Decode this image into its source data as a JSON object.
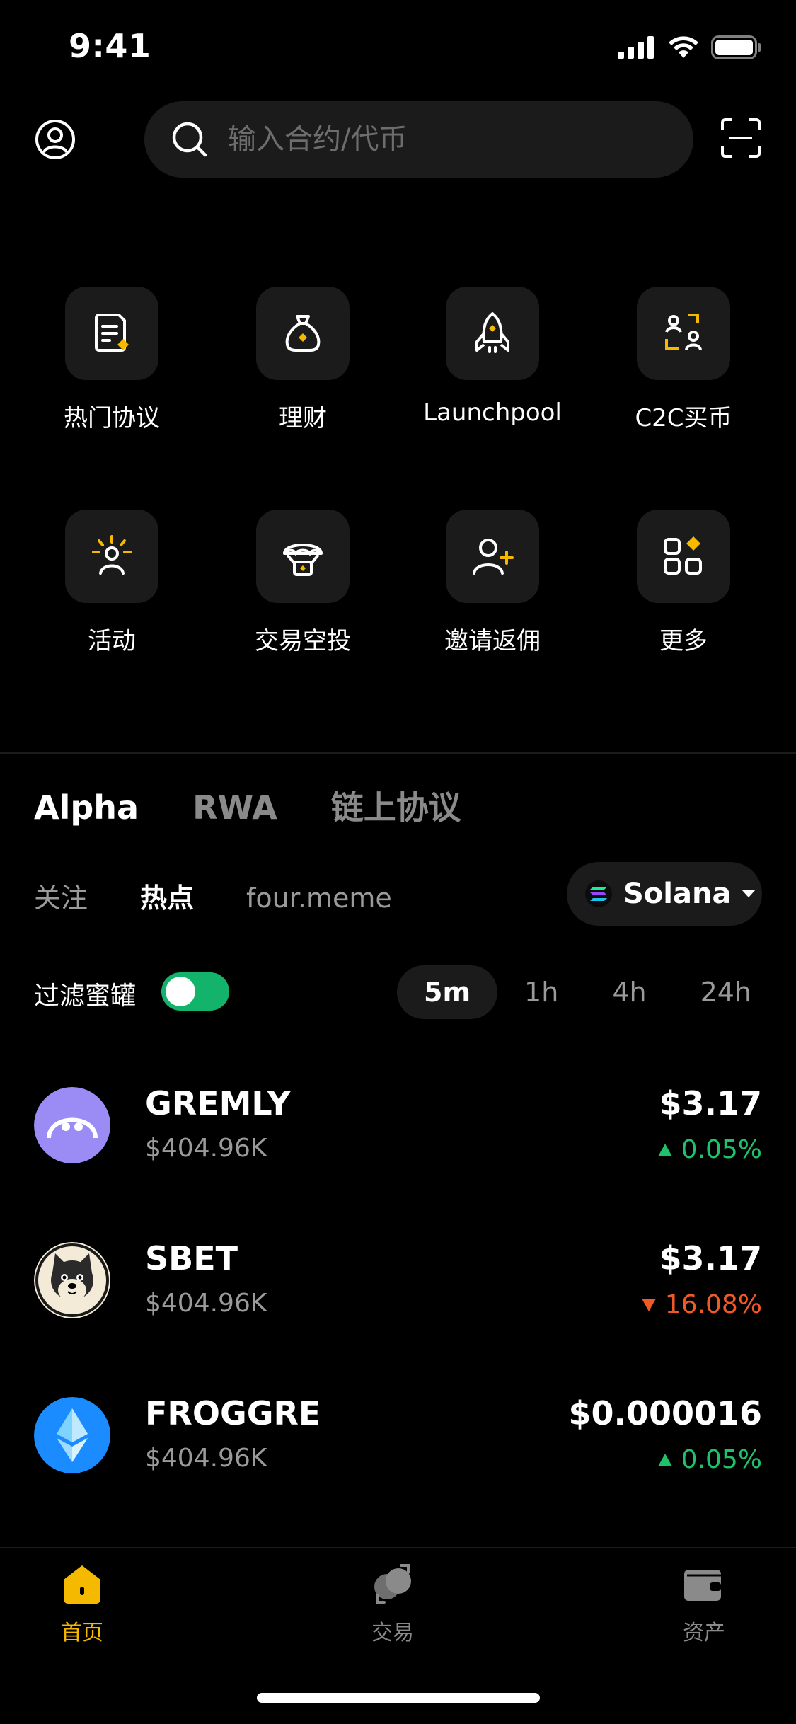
{
  "status": {
    "time": "9:41"
  },
  "search": {
    "placeholder": "输入合约/代币"
  },
  "quick_actions": [
    {
      "label": "热门协议",
      "icon": "document-icon"
    },
    {
      "label": "理财",
      "icon": "money-bag-icon"
    },
    {
      "label": "Launchpool",
      "icon": "rocket-icon"
    },
    {
      "label": "C2C买币",
      "icon": "users-exchange-icon"
    },
    {
      "label": "活动",
      "icon": "sun-person-icon"
    },
    {
      "label": "交易空投",
      "icon": "airdrop-icon"
    },
    {
      "label": "邀请返佣",
      "icon": "add-user-icon"
    },
    {
      "label": "更多",
      "icon": "apps-icon"
    }
  ],
  "main_tabs": [
    {
      "label": "Alpha",
      "active": true
    },
    {
      "label": "RWA",
      "active": false
    },
    {
      "label": "链上协议",
      "active": false
    }
  ],
  "sub_tabs": [
    {
      "label": "关注",
      "active": false
    },
    {
      "label": "热点",
      "active": true
    },
    {
      "label": "four.meme",
      "active": false
    }
  ],
  "chain": {
    "label": "Solana"
  },
  "filter": {
    "label": "过滤蜜罐",
    "enabled": true
  },
  "periods": [
    {
      "label": "5m",
      "active": true
    },
    {
      "label": "1h",
      "active": false
    },
    {
      "label": "4h",
      "active": false
    },
    {
      "label": "24h",
      "active": false
    }
  ],
  "tokens": [
    {
      "name": "GREMLY",
      "mcap": "$404.96K",
      "price": "$3.17",
      "change": "0.05%",
      "direction": "up"
    },
    {
      "name": "SBET",
      "mcap": "$404.96K",
      "price": "$3.17",
      "change": "16.08%",
      "direction": "down"
    },
    {
      "name": "FROGGRE",
      "mcap": "$404.96K",
      "price": "$0.000016",
      "change": "0.05%",
      "direction": "up"
    }
  ],
  "bottom_nav": [
    {
      "label": "首页",
      "active": true
    },
    {
      "label": "交易",
      "active": false
    },
    {
      "label": "资产",
      "active": false
    }
  ],
  "colors": {
    "accent": "#f5b900",
    "up": "#1fc16b",
    "down": "#f15a24",
    "toggle": "#13b36b"
  }
}
